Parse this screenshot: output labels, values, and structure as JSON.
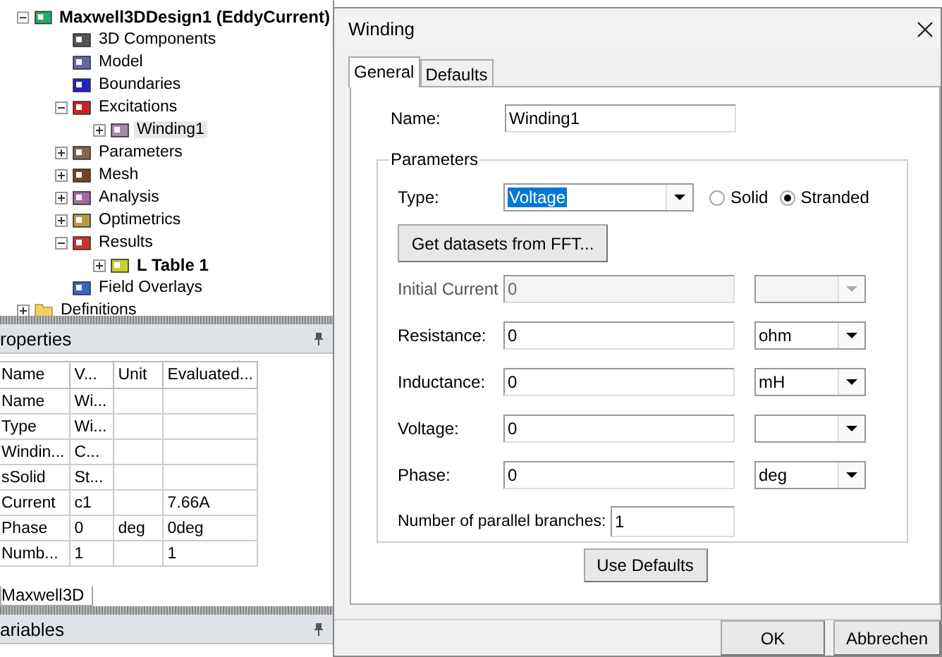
{
  "tree": {
    "label": "Maxwell3DDesign1 (EddyCurrent)",
    "bold": true,
    "expanded": true,
    "selected": false,
    "children": [
      {
        "label": "3D Components",
        "selected": false
      },
      {
        "label": "Model",
        "selected": false
      },
      {
        "label": "Boundaries",
        "selected": false
      },
      {
        "label": "Excitations",
        "expanded": true,
        "selected": false,
        "children": [
          {
            "label": "Winding1",
            "expanded": false,
            "selected": true
          }
        ]
      },
      {
        "label": "Parameters",
        "expanded": false,
        "selected": false
      },
      {
        "label": "Mesh",
        "expanded": false,
        "selected": false
      },
      {
        "label": "Analysis",
        "expanded": false,
        "selected": false
      },
      {
        "label": "Optimetrics",
        "expanded": false,
        "selected": false
      },
      {
        "label": "Results",
        "expanded": true,
        "selected": false,
        "children": [
          {
            "label": "L Table 1",
            "bold": true,
            "expanded": false,
            "selected": false
          }
        ]
      },
      {
        "label": "Field Overlays",
        "selected": false
      }
    ]
  },
  "tree_next": {
    "label": "Definitions",
    "expanded": false
  },
  "properties": {
    "title": "roperties",
    "columns": [
      "Name",
      "V...",
      "Unit",
      "Evaluated..."
    ],
    "rows": [
      [
        "Name",
        "Wi...",
        "",
        ""
      ],
      [
        "Type",
        "Wi...",
        "",
        ""
      ],
      [
        "Windin...",
        "C...",
        "",
        ""
      ],
      [
        "sSolid",
        "St...",
        "",
        ""
      ],
      [
        "Current",
        "c1",
        "",
        "7.66A"
      ],
      [
        "Phase",
        "0",
        "deg",
        "0deg"
      ],
      [
        "Numb...",
        "1",
        "",
        "1"
      ]
    ],
    "tab": "Maxwell3D"
  },
  "variables": {
    "title": "ariables"
  },
  "dialog": {
    "title": "Winding",
    "tabs": [
      {
        "label": "General",
        "selected": true
      },
      {
        "label": "Defaults",
        "selected": false
      }
    ],
    "name_label": "Name:",
    "name_value": "Winding1",
    "group": "Parameters",
    "type_label": "Type:",
    "type_value": "Voltage",
    "radios": [
      {
        "label": "Solid",
        "selected": false
      },
      {
        "label": "Stranded",
        "selected": true
      }
    ],
    "fft_button": "Get datasets from FFT...",
    "rows": [
      {
        "label": "Initial Current",
        "value": "0",
        "disabled": true
      },
      {
        "label": "Resistance:",
        "value": "0",
        "unit": "ohm",
        "disabled": false
      },
      {
        "label": "Inductance:",
        "value": "0",
        "unit": "mH",
        "disabled": false
      },
      {
        "label": "Voltage:",
        "value": "0",
        "disabled": false
      },
      {
        "label": "Phase:",
        "value": "0",
        "unit": "deg",
        "disabled": false
      }
    ],
    "branches_label": "Number of parallel branches:",
    "branches_value": "1",
    "defaults_button": "Use Defaults",
    "buttons": [
      "OK",
      "Abbrechen"
    ]
  }
}
